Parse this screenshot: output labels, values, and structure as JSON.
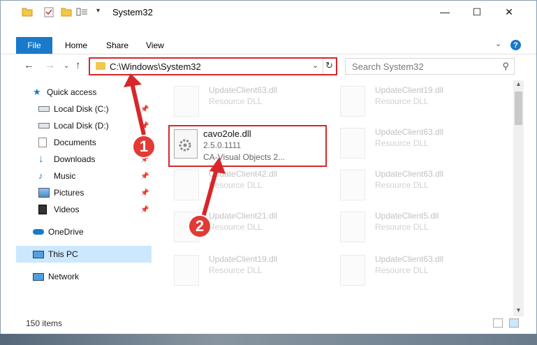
{
  "window": {
    "title": "System32"
  },
  "controls": {
    "minimize": "—",
    "maximize": "☐",
    "close": "✕"
  },
  "ribbon": {
    "file": "File",
    "home": "Home",
    "share": "Share",
    "view": "View",
    "help": "?"
  },
  "address": {
    "path": "C:\\Windows\\System32",
    "search_placeholder": "Search System32"
  },
  "nav": {
    "quick_access": "Quick access",
    "items": [
      {
        "label": "Local Disk (C:)",
        "pinned": true
      },
      {
        "label": "Local Disk (D:)",
        "pinned": true
      },
      {
        "label": "Documents",
        "pinned": true
      },
      {
        "label": "Downloads",
        "pinned": true
      },
      {
        "label": "Music",
        "pinned": true
      },
      {
        "label": "Pictures",
        "pinned": true
      },
      {
        "label": "Videos",
        "pinned": true
      }
    ],
    "onedrive": "OneDrive",
    "this_pc": "This PC",
    "network": "Network"
  },
  "files": [
    {
      "name": "UpdateClient63.dll",
      "type": "Resource DLL"
    },
    {
      "name": "UpdateClient19.dll",
      "type": "Resource DLL"
    },
    {
      "name": "UpdateClient63.dll",
      "type": "Resource DLL"
    },
    {
      "name": "UpdateClient42.dll",
      "type": "Resource DLL"
    },
    {
      "name": "UpdateClient63.dll",
      "type": "Resource DLL"
    },
    {
      "name": "UpdateClient21.dll",
      "type": "Resource DLL"
    },
    {
      "name": "UpdateClient5.dll",
      "type": "Resource DLL"
    },
    {
      "name": "UpdateClient19.dll",
      "type": "Resource DLL"
    },
    {
      "name": "UpdateClient63.dll",
      "type": "Resource DLL"
    }
  ],
  "focus_file": {
    "name": "cavo2ole.dll",
    "version": "2.5.0.1111",
    "description": "CA-Visual Objects 2..."
  },
  "status": {
    "count": "150 items"
  },
  "markers": {
    "one": "1",
    "two": "2"
  },
  "colors": {
    "accent": "#1979ca",
    "highlight": "#d7272a",
    "selection": "#cce8ff"
  }
}
